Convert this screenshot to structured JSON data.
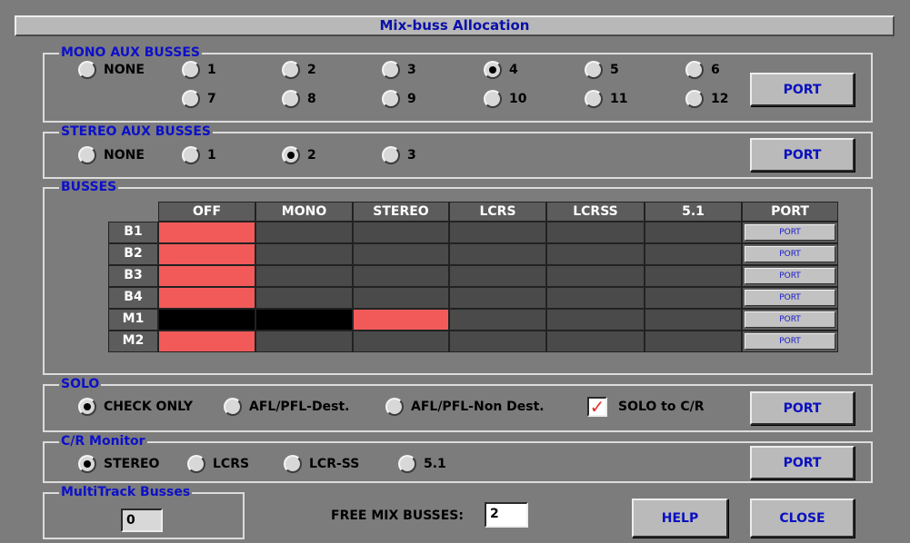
{
  "window": {
    "title": "Mix-buss Allocation"
  },
  "mono_aux": {
    "label": "MONO AUX BUSSES",
    "options": [
      "NONE",
      "1",
      "2",
      "3",
      "4",
      "5",
      "6",
      "7",
      "8",
      "9",
      "10",
      "11",
      "12"
    ],
    "selected": "4",
    "port_label": "PORT"
  },
  "stereo_aux": {
    "label": "STEREO AUX BUSSES",
    "options": [
      "NONE",
      "1",
      "2",
      "3"
    ],
    "selected": "2",
    "port_label": "PORT"
  },
  "busses": {
    "label": "BUSSES",
    "columns": [
      "OFF",
      "MONO",
      "STEREO",
      "LCRS",
      "LCRSS",
      "5.1",
      "PORT"
    ],
    "rows": [
      {
        "name": "B1",
        "state": "OFF",
        "port": "PORT"
      },
      {
        "name": "B2",
        "state": "OFF",
        "port": "PORT"
      },
      {
        "name": "B3",
        "state": "OFF",
        "port": "PORT"
      },
      {
        "name": "B4",
        "state": "OFF",
        "port": "PORT"
      },
      {
        "name": "M1",
        "state": "STEREO",
        "disabled": [
          "OFF",
          "MONO"
        ],
        "port": "PORT"
      },
      {
        "name": "M2",
        "state": "OFF",
        "port": "PORT"
      }
    ],
    "colors": {
      "active": "#f25a5a",
      "inactive": "#4a4a4a",
      "disabled": "#000000"
    }
  },
  "solo": {
    "label": "SOLO",
    "options": [
      "CHECK ONLY",
      "AFL/PFL-Dest.",
      "AFL/PFL-Non Dest."
    ],
    "selected": "CHECK ONLY",
    "checkbox_label": "SOLO to C/R",
    "checkbox_checked": true,
    "port_label": "PORT"
  },
  "cr_monitor": {
    "label": "C/R Monitor",
    "options": [
      "STEREO",
      "LCRS",
      "LCR-SS",
      "5.1"
    ],
    "selected": "STEREO",
    "port_label": "PORT"
  },
  "multitrack": {
    "label": "MultiTrack Busses",
    "value": "0"
  },
  "free_mix": {
    "label": "FREE MIX BUSSES:",
    "value": "2"
  },
  "buttons": {
    "help": "HELP",
    "close": "CLOSE"
  }
}
